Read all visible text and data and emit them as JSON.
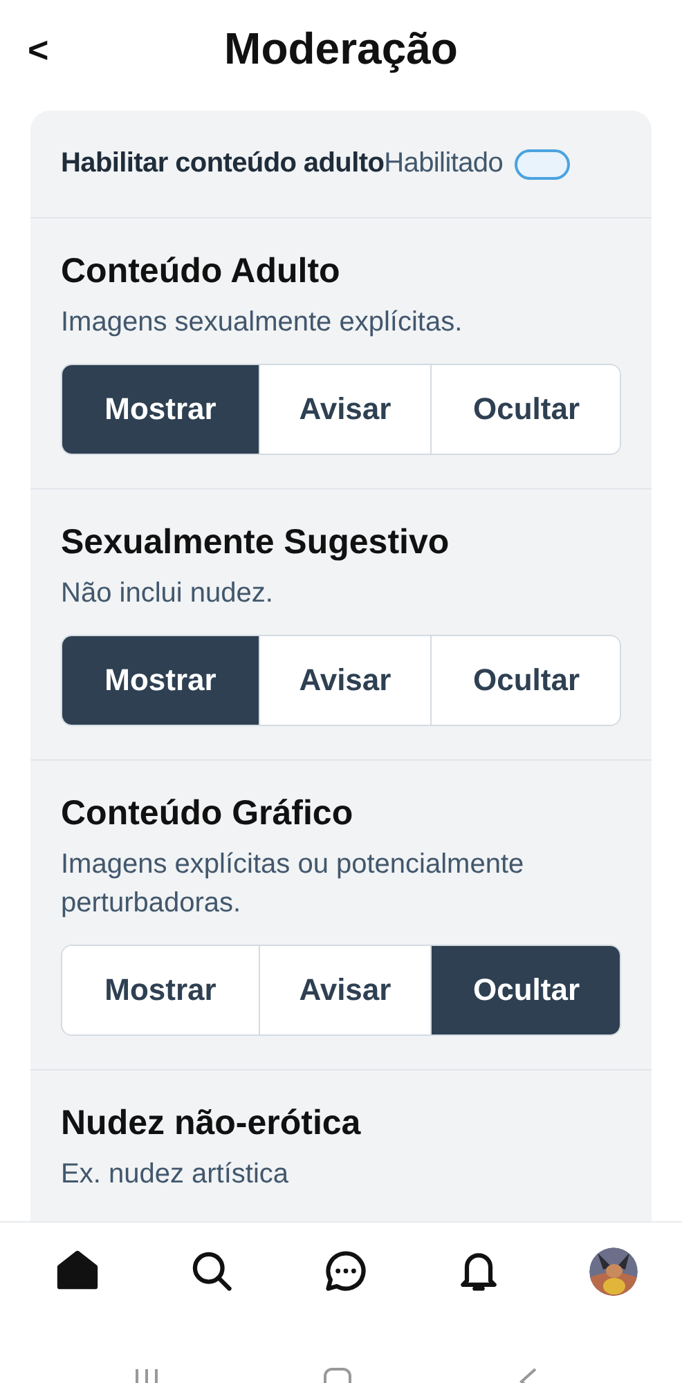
{
  "header": {
    "back": "<",
    "title": "Moderação"
  },
  "adult_toggle": {
    "label": "Habilitar conteúdo adulto",
    "value": "Habilitado",
    "on": true
  },
  "sections": [
    {
      "title": "Conteúdo Adulto",
      "description": "Imagens sexualmente explícitas.",
      "options": [
        {
          "label": "Mostrar",
          "selected": true
        },
        {
          "label": "Avisar",
          "selected": false
        },
        {
          "label": "Ocultar",
          "selected": false
        }
      ]
    },
    {
      "title": "Sexualmente Sugestivo",
      "description": "Não inclui nudez.",
      "options": [
        {
          "label": "Mostrar",
          "selected": true
        },
        {
          "label": "Avisar",
          "selected": false
        },
        {
          "label": "Ocultar",
          "selected": false
        }
      ]
    },
    {
      "title": "Conteúdo Gráfico",
      "description": "Imagens explícitas ou potencialmente perturbadoras.",
      "options": [
        {
          "label": "Mostrar",
          "selected": false
        },
        {
          "label": "Avisar",
          "selected": false
        },
        {
          "label": "Ocultar",
          "selected": true
        }
      ]
    },
    {
      "title": "Nudez não-erótica",
      "description": "Ex. nudez artística"
    }
  ],
  "bottom_nav": [
    {
      "kind": "home",
      "selected": true
    },
    {
      "kind": "search",
      "selected": false
    },
    {
      "kind": "chat",
      "selected": false
    },
    {
      "kind": "bell",
      "selected": false
    },
    {
      "kind": "avatar",
      "selected": false
    }
  ]
}
